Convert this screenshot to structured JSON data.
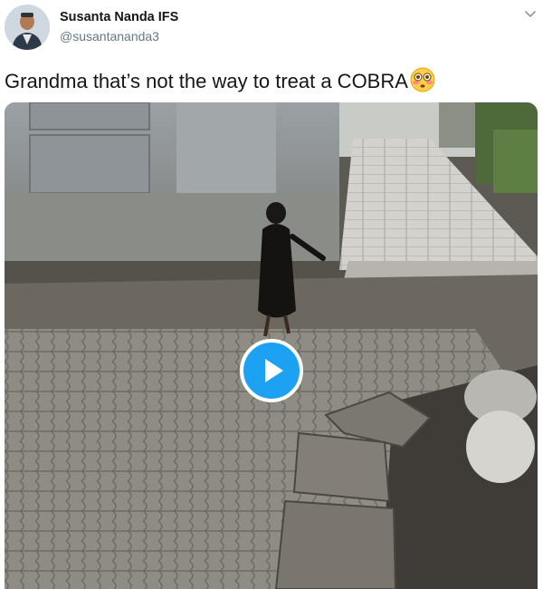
{
  "author": {
    "display_name": "Susanta Nanda IFS",
    "handle": "@susantananda3"
  },
  "tweet": {
    "text": "Grandma that’s not the way to treat a COBRA",
    "emoji": "flushed-face-emoji"
  },
  "media": {
    "type": "video",
    "play_icon": "play-icon"
  },
  "icons": {
    "menu": "chevron-down-icon",
    "avatar": "avatar"
  },
  "colors": {
    "accent": "#1da1f2",
    "text_primary": "#14171a",
    "text_secondary": "#657786"
  }
}
